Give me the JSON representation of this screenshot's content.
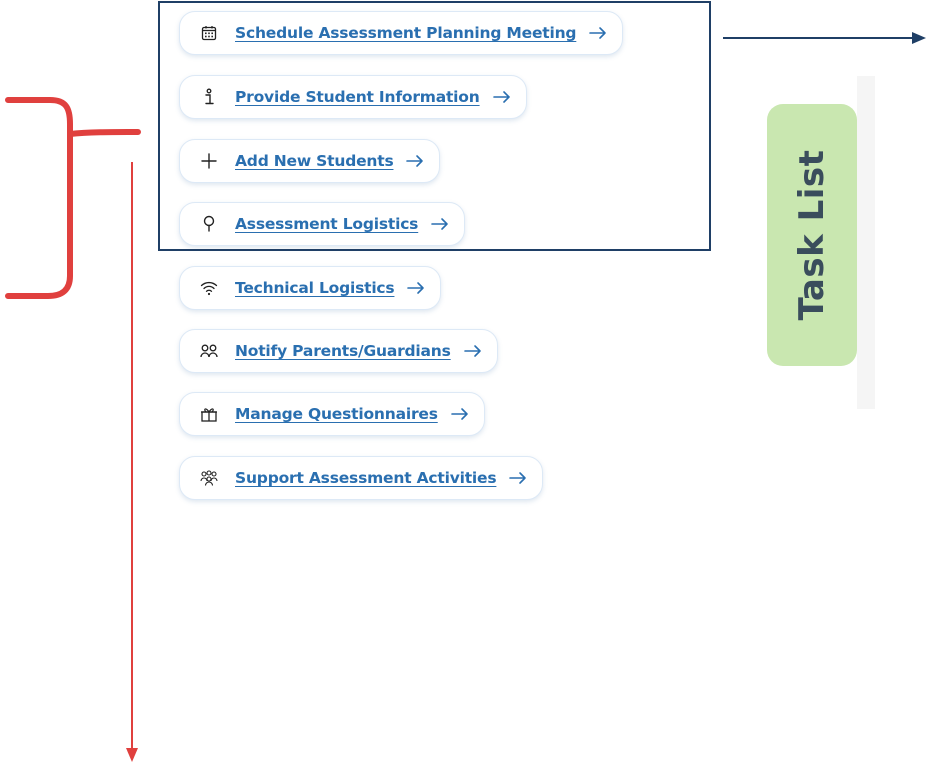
{
  "tasks": [
    {
      "label": "Schedule Assessment Planning Meeting",
      "icon": "calendar-icon"
    },
    {
      "label": "Provide Student Information",
      "icon": "info-icon"
    },
    {
      "label": "Add New Students",
      "icon": "plus-icon"
    },
    {
      "label": "Assessment Logistics",
      "icon": "pin-icon"
    },
    {
      "label": "Technical Logistics",
      "icon": "wifi-icon"
    },
    {
      "label": "Notify Parents/Guardians",
      "icon": "people-icon"
    },
    {
      "label": "Manage Questionnaires",
      "icon": "gift-icon"
    },
    {
      "label": "Support Assessment Activities",
      "icon": "group-icon"
    }
  ],
  "task_list_tab": {
    "label": "Task List"
  },
  "colors": {
    "link": "#2a6fb0",
    "tab_background": "#c9e7b0",
    "tab_text": "#3a4d5c",
    "selection_box": "#1f3f66",
    "annotation_red": "#e0403e",
    "annotation_navy": "#1f3f66"
  }
}
